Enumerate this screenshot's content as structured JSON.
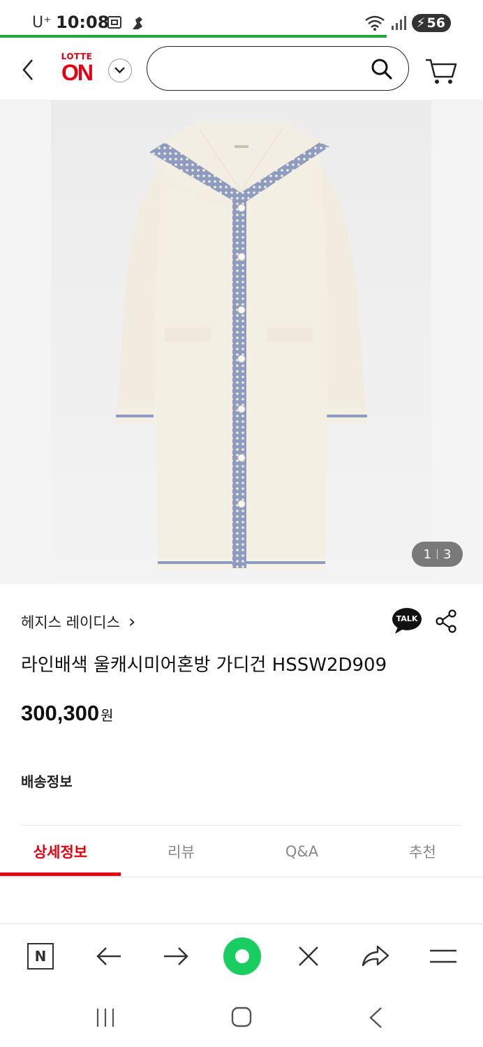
{
  "status_bar": {
    "carrier": "U⁺",
    "time": "10:08",
    "battery": "56",
    "page_load_progress": 0.8
  },
  "header": {
    "logo_top": "LOTTE",
    "logo_main": "ON",
    "search_placeholder": "",
    "icons": [
      "back-icon",
      "chevron-down-icon",
      "search-icon",
      "cart-icon"
    ]
  },
  "gallery": {
    "current": "1",
    "total": "3"
  },
  "product": {
    "brand": "헤지스 레이디스",
    "brand_chevron": "›",
    "title": "라인배색 울캐시미어혼방 가디건 HSSW2D909",
    "price": "300,300",
    "currency": "원",
    "talk_label": "TALK"
  },
  "shipping": {
    "label": "배송정보"
  },
  "tabs": [
    {
      "label": "상세정보",
      "active": true
    },
    {
      "label": "리뷰",
      "active": false
    },
    {
      "label": "Q&A",
      "active": false
    },
    {
      "label": "추천",
      "active": false
    }
  ],
  "browser_bar": {
    "n_label": "N",
    "icons": [
      "naver-n-icon",
      "back-arrow-icon",
      "forward-arrow-icon",
      "home-dot-icon",
      "close-icon",
      "share-arrow-icon",
      "menu-icon"
    ]
  },
  "colors": {
    "accent": "#e60012",
    "progress": "#1fa83a",
    "naver_green": "#19ce60"
  }
}
